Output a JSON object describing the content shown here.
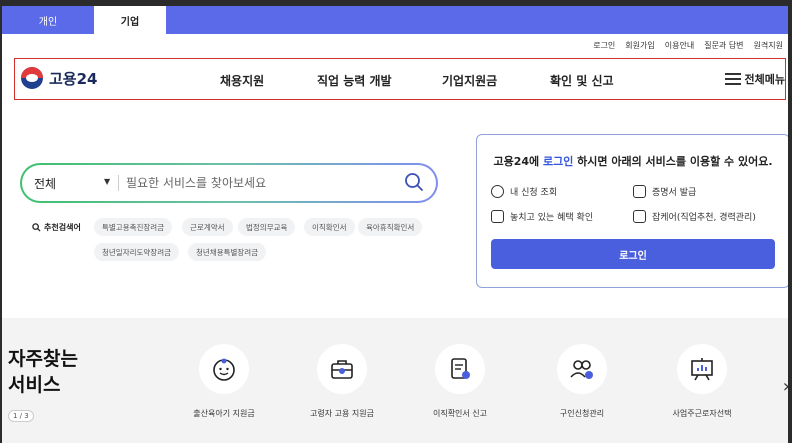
{
  "tabs": [
    {
      "label": "개인",
      "active": false
    },
    {
      "label": "기업",
      "active": true
    }
  ],
  "utility_links": [
    "로그인",
    "회원가입",
    "이용안내",
    "질문과 답변",
    "원격지원"
  ],
  "header": {
    "logo_text": "고용24",
    "nav": [
      "채용지원",
      "직업 능력 개발",
      "기업지원금",
      "확인 및 신고"
    ],
    "menu_label": "전체메뉴"
  },
  "search": {
    "scope": "전체",
    "placeholder": "필요한 서비스를 찾아보세요",
    "recommended_label": "추천검색어",
    "keywords": [
      "특별고용촉진장려금",
      "근로계약서",
      "법정의무교육",
      "이직확인서",
      "육아휴직확인서",
      "청년일자리도약장려금",
      "청년채용특별장려금"
    ]
  },
  "login_card": {
    "title_pre": "고용24에 ",
    "title_link": "로그인",
    "title_post": " 하시면 아래의 서비스를 이용할 수 있어요.",
    "items": [
      "내 신청 조회",
      "증명서 발급",
      "놓치고 있는 혜택 확인",
      "잡케어(직업추천, 경력관리)"
    ],
    "button": "로그인"
  },
  "frequent": {
    "title_line1": "자주찾는",
    "title_line2": "서비스",
    "pager": "1 / 3",
    "services": [
      "출산육아기 지원금",
      "고령자 고용 지원금",
      "이직확인서 신고",
      "구인신청관리",
      "사업주근로자선택"
    ]
  },
  "colors": {
    "accent": "#5b6ae8",
    "brand_navy": "#1b2a5b",
    "highlight": "#d32f2f"
  }
}
